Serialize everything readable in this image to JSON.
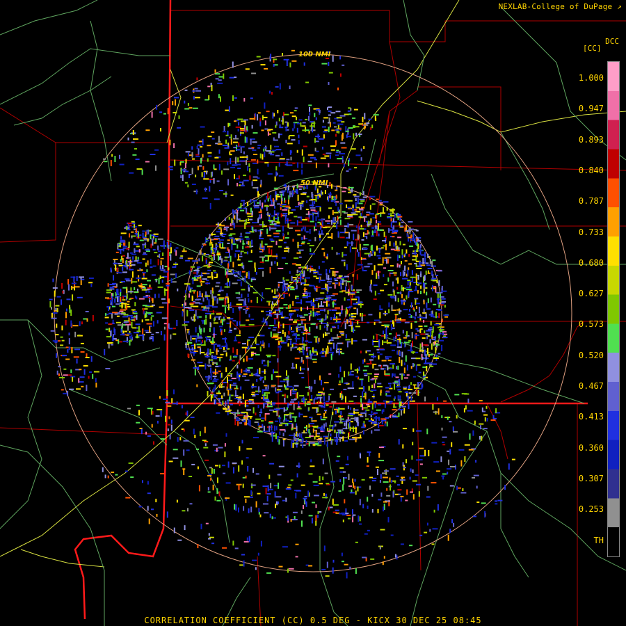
{
  "credit": "NEXLAB-College of DuPage",
  "product_code": "DCC",
  "product_unit": "[CC]",
  "range_rings": [
    {
      "label": "100 NMI"
    },
    {
      "label": "50 NMI"
    }
  ],
  "colorbar": {
    "labels": [
      "1.000",
      "0.947",
      "0.893",
      "0.840",
      "0.787",
      "0.733",
      "0.680",
      "0.627",
      "0.573",
      "0.520",
      "0.467",
      "0.413",
      "0.360",
      "0.307",
      "0.253",
      "TH"
    ],
    "colors": [
      "#ff9ec8",
      "#f070a8",
      "#d02050",
      "#c00000",
      "#ff5000",
      "#ffa000",
      "#ffe000",
      "#c8d800",
      "#80c800",
      "#50e050",
      "#9090e0",
      "#6060d0",
      "#2030e0",
      "#1020c0",
      "#303090",
      "#909090",
      "#000000"
    ]
  },
  "footer": "CORRELATION COEFFICIENT (CC) 0.5 DEG - KICX 30 DEC 25 08:45"
}
